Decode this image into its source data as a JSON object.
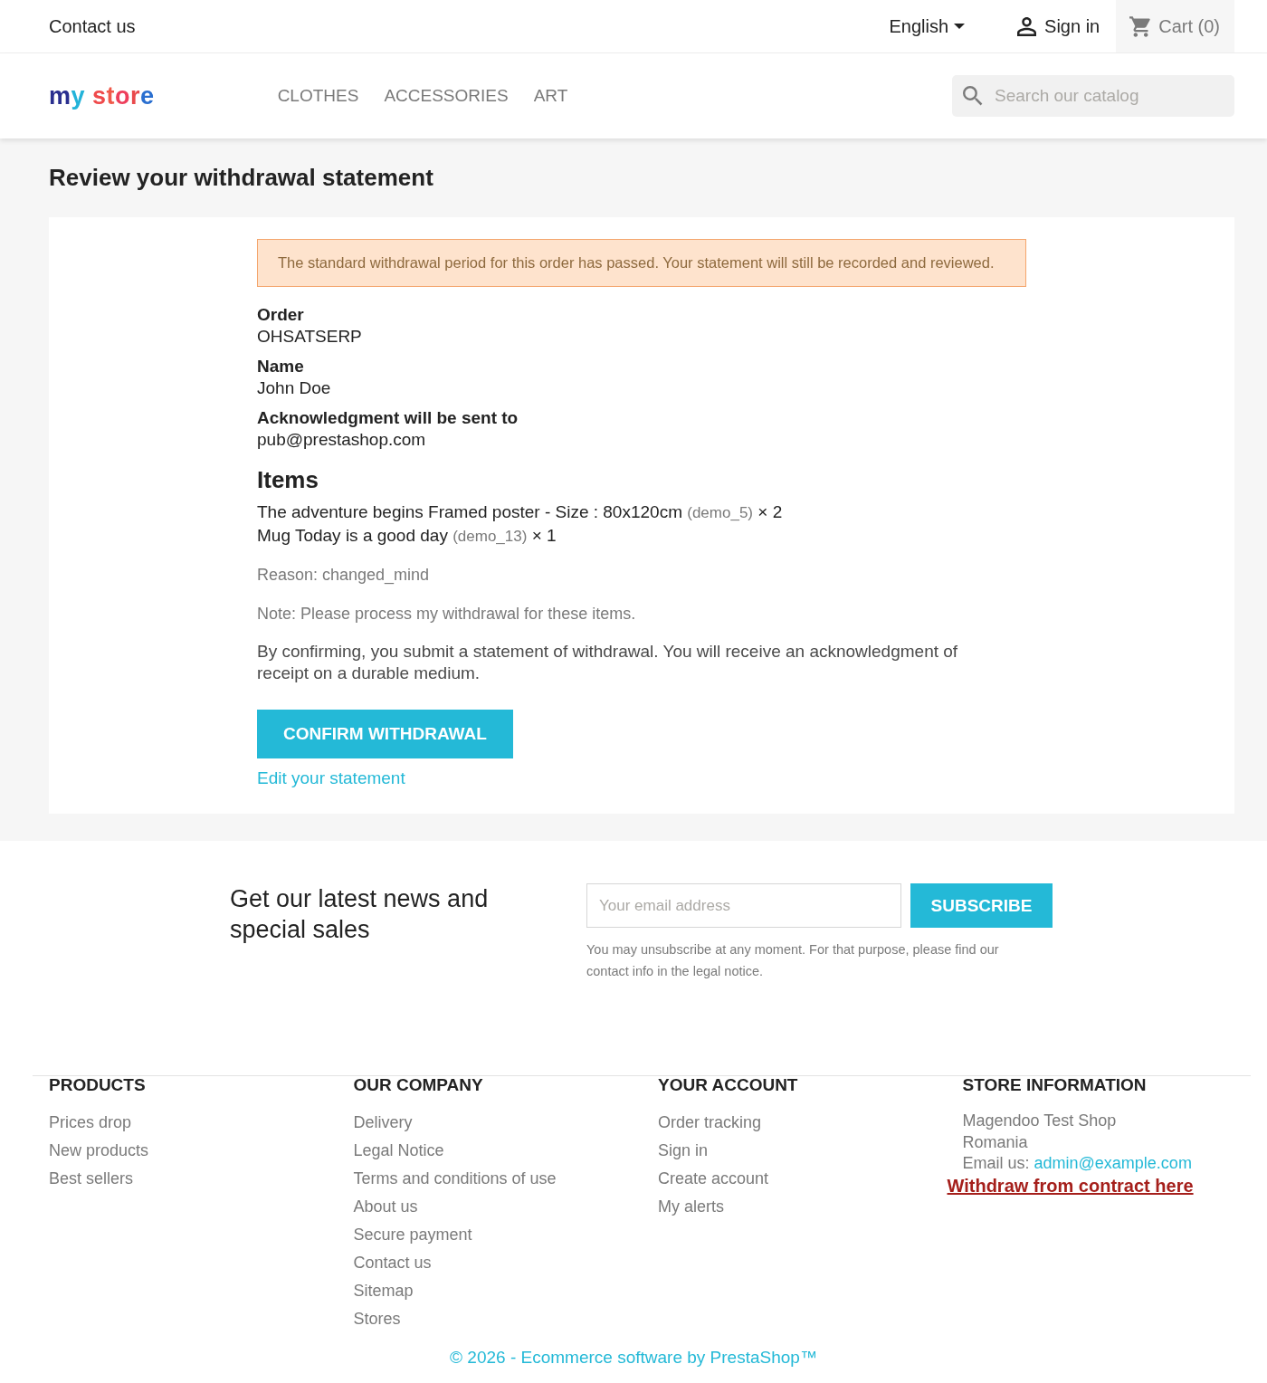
{
  "top_bar": {
    "contact": "Contact us",
    "language": "English",
    "sign_in": "Sign in",
    "cart": "Cart (0)"
  },
  "header": {
    "logo": "my store",
    "menu": [
      "CLOTHES",
      "ACCESSORIES",
      "ART"
    ],
    "search": {
      "placeholder": "Search our catalog"
    }
  },
  "page": {
    "title": "Review your withdrawal statement",
    "alert": "The standard withdrawal period for this order has passed. Your statement will still be recorded and reviewed.",
    "details": [
      {
        "label": "Order",
        "value": "OHSATSERP"
      },
      {
        "label": "Name",
        "value": "John Doe"
      },
      {
        "label": "Acknowledgment will be sent to",
        "value": "pub@prestashop.com"
      }
    ],
    "items_heading": "Items",
    "items": [
      {
        "name": "The adventure begins Framed poster - Size : 80x120cm",
        "reference": "(demo_5)",
        "quantity": "× 2"
      },
      {
        "name": "Mug Today is a good day",
        "reference": "(demo_13)",
        "quantity": "× 1"
      }
    ],
    "reason": "Reason: changed_mind",
    "note": "Note: Please process my withdrawal for these items.",
    "disclaimer": "By confirming, you submit a statement of withdrawal. You will receive an acknowledgment of receipt on a durable medium.",
    "confirm_button": "CONFIRM WITHDRAWAL",
    "edit_link": "Edit your statement"
  },
  "newsletter": {
    "heading": "Get our latest news and special sales",
    "email": {
      "placeholder": "Your email address"
    },
    "button": "SUBSCRIBE",
    "notice": "You may unsubscribe at any moment. For that purpose, please find our contact info in the legal notice."
  },
  "footer": {
    "columns": [
      {
        "title": "PRODUCTS",
        "links": [
          "Prices drop",
          "New products",
          "Best sellers"
        ]
      },
      {
        "title": "OUR COMPANY",
        "links": [
          "Delivery",
          "Legal Notice",
          "Terms and conditions of use",
          "About us",
          "Secure payment",
          "Contact us",
          "Sitemap",
          "Stores"
        ]
      },
      {
        "title": "YOUR ACCOUNT",
        "links": [
          "Order tracking",
          "Sign in",
          "Create account",
          "My alerts"
        ]
      }
    ],
    "store_info": {
      "title": "STORE INFORMATION",
      "lines": [
        "Magendoo Test Shop",
        "Romania"
      ],
      "email_label": "Email us:",
      "email": "admin@example.com",
      "withdraw_link": "Withdraw from contract here"
    },
    "copyright": "© 2026 - Ecommerce software by PrestaShop™"
  }
}
